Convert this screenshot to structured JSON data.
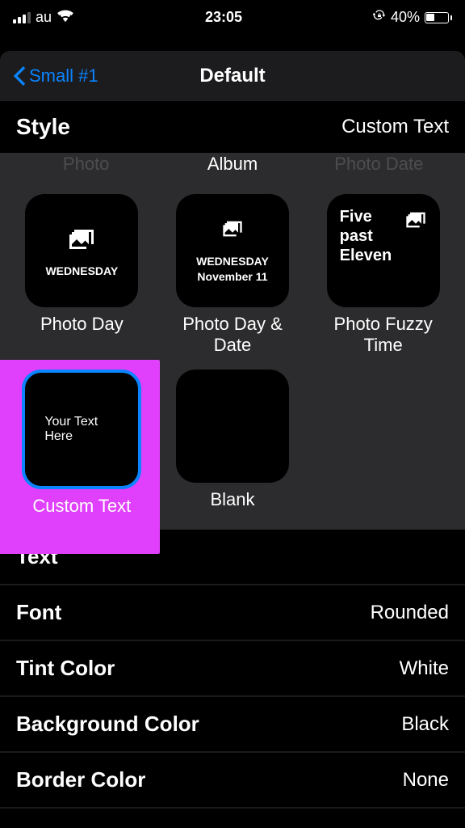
{
  "status": {
    "carrier": "au",
    "time": "23:05",
    "battery_pct": "40%"
  },
  "nav": {
    "back_label": "Small #1",
    "title": "Default"
  },
  "section": {
    "title": "Style",
    "value": "Custom Text"
  },
  "partial_row": {
    "left": "Photo",
    "center": "Album",
    "right": "Photo Date"
  },
  "widgets": {
    "photo_day": {
      "text": "WEDNESDAY",
      "label": "Photo Day"
    },
    "photo_day_date": {
      "line1": "WEDNESDAY",
      "line2": "November 11",
      "label": "Photo Day & Date"
    },
    "fuzzy_time": {
      "text": "Five past Eleven",
      "label": "Photo Fuzzy Time"
    },
    "custom_text": {
      "text": "Your Text Here",
      "label": "Custom Text"
    },
    "blank": {
      "label": "Blank"
    }
  },
  "settings": {
    "text": {
      "label": "Text",
      "value": ""
    },
    "font": {
      "label": "Font",
      "value": "Rounded"
    },
    "tint_color": {
      "label": "Tint Color",
      "value": "White"
    },
    "bg_color": {
      "label": "Background Color",
      "value": "Black"
    },
    "border_color": {
      "label": "Border Color",
      "value": "None"
    }
  }
}
